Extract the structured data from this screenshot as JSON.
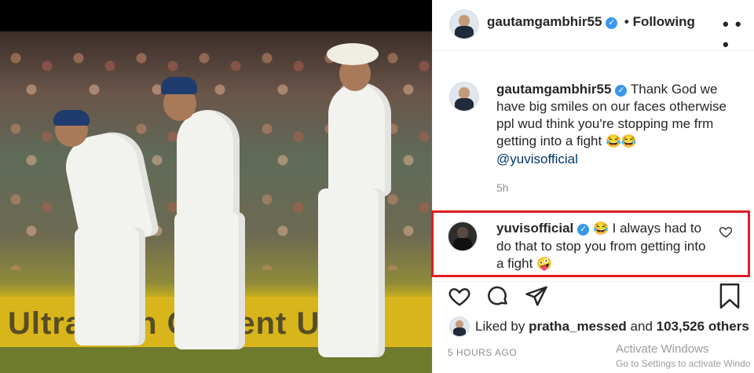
{
  "post": {
    "author": "gautamgambhir55",
    "follow_state": "• Following",
    "more_icon": "more-horizontal-icon"
  },
  "caption": {
    "author": "gautamgambhir55",
    "text": "Thank God we have big smiles on our faces otherwise ppl wud think you're stopping me frm getting into a fight",
    "emojis": "😂😂",
    "mention": "@yuvisofficial",
    "time": "5h"
  },
  "comment": {
    "author": "yuvisofficial",
    "text_emoji": "😂",
    "text": "I always had to do that to stop you from getting into a fight",
    "end_emoji": "🤪",
    "highlight_color": "#e11b22"
  },
  "actions": {
    "like_icon": "heart-icon",
    "comment_icon": "comment-icon",
    "share_icon": "share-icon",
    "save_icon": "bookmark-icon"
  },
  "likes": {
    "prefix": "Liked by",
    "user": "pratha_messed",
    "connector": "and",
    "count": "103,526 others"
  },
  "timestamp": "5 HOURS AGO",
  "photo": {
    "banner_text": "UltraTech Cement Ult"
  },
  "watermark": {
    "line1": "Activate Windows",
    "line2": "Go to Settings to activate Windo"
  },
  "colors": {
    "verified": "#3897f0",
    "mention": "#00376b",
    "muted": "#8e8e8e"
  }
}
